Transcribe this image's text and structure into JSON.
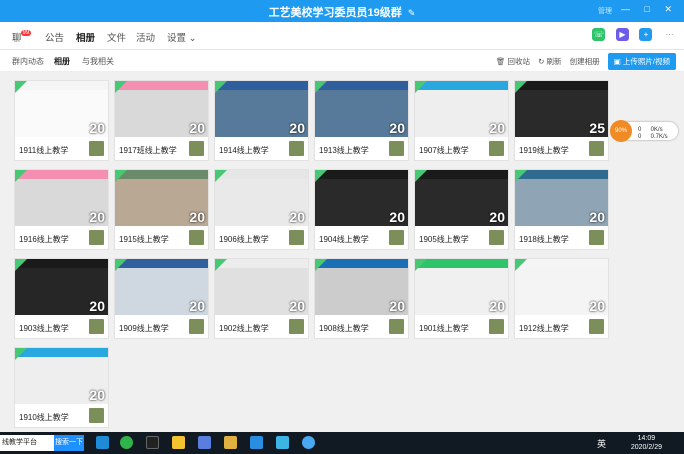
{
  "window": {
    "title": "工艺美校学习委员员19级群",
    "edit_icon": "✎",
    "controls_label": "管理",
    "controls": "— □ ✕"
  },
  "tabs": [
    {
      "label": "聊",
      "badge": "99"
    },
    {
      "label": "公告"
    },
    {
      "label": "相册"
    },
    {
      "label": "文件"
    },
    {
      "label": "活动"
    },
    {
      "label": "设置 ⌄"
    }
  ],
  "subtabs": [
    "群内动态",
    "相册",
    "与我相关"
  ],
  "actions": {
    "recycle": "回收站",
    "refresh": "刷新",
    "create": "创建相册",
    "upload": "上传照片/视频"
  },
  "albums": [
    {
      "name": "1911线上教学",
      "count": "20",
      "bar": "#f5f5f5",
      "body": "#fafafa"
    },
    {
      "name": "1917班线上教学",
      "count": "20",
      "bar": "#f48fb1",
      "body": "#d9d9d9"
    },
    {
      "name": "1914线上教学",
      "count": "20",
      "bar": "#2f5f9c",
      "body": "#587a9a"
    },
    {
      "name": "1913线上教学",
      "count": "20",
      "bar": "#2f5f9c",
      "body": "#587a9a"
    },
    {
      "name": "1907线上教学",
      "count": "20",
      "bar": "#29a8e0",
      "body": "#eeeeee"
    },
    {
      "name": "1919线上教学",
      "count": "25",
      "bar": "#1a1a1a",
      "body": "#2a2a2a"
    },
    {
      "name": "1916线上教学",
      "count": "20",
      "bar": "#f48fb1",
      "body": "#d9d9d9"
    },
    {
      "name": "1915线上教学",
      "count": "20",
      "bar": "#6a8a6a",
      "body": "#b8a894"
    },
    {
      "name": "1906线上教学",
      "count": "20",
      "bar": "#e6e6e6",
      "body": "#e9e9e9"
    },
    {
      "name": "1904线上教学",
      "count": "20",
      "bar": "#1a1a1a",
      "body": "#2a2a2a"
    },
    {
      "name": "1905线上教学",
      "count": "20",
      "bar": "#1a1a1a",
      "body": "#2a2a2a"
    },
    {
      "name": "1918线上教学",
      "count": "20",
      "bar": "#2f6b8e",
      "body": "#8fa5b5"
    },
    {
      "name": "1903线上教学",
      "count": "20",
      "bar": "#1a1a1a",
      "body": "#262626"
    },
    {
      "name": "1909线上教学",
      "count": "20",
      "bar": "#2f5f9c",
      "body": "#cfd8e0"
    },
    {
      "name": "1902线上教学",
      "count": "20",
      "bar": "#ececec",
      "body": "#e0e0e0"
    },
    {
      "name": "1908线上教学",
      "count": "20",
      "bar": "#1b6fb5",
      "body": "#cccccc"
    },
    {
      "name": "1901线上教学",
      "count": "20",
      "bar": "#2ec46a",
      "body": "#f0f0f0"
    },
    {
      "name": "1912线上教学",
      "count": "20",
      "bar": "#f5f5f5",
      "body": "#f4f4f4"
    },
    {
      "name": "1910线上教学",
      "count": "20",
      "bar": "#29a8e0",
      "body": "#eeeeee"
    }
  ],
  "float_widget": {
    "percent": "90%",
    "line1": "0 　 0K/s",
    "line2": "0 　 0.7K/s"
  },
  "taskbar": {
    "search_text": "线教学平台",
    "search_button": "搜索一下",
    "ime": "英",
    "time": "14:09",
    "date": "2020/2/29"
  }
}
